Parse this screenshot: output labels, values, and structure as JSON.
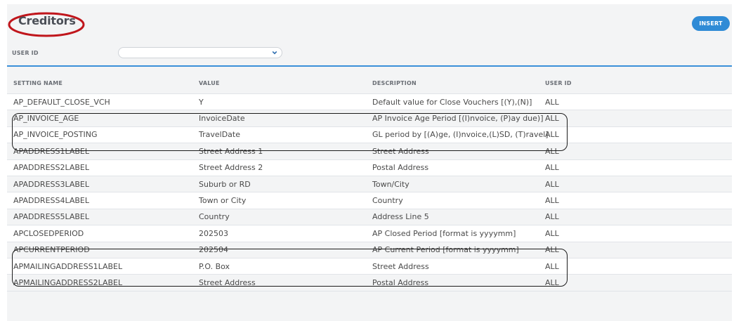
{
  "header": {
    "title": "Creditors",
    "insert_label": "INSERT"
  },
  "filter": {
    "user_id_label": "USER ID",
    "user_id_value": ""
  },
  "table": {
    "columns": [
      "SETTING NAME",
      "VALUE",
      "DESCRIPTION",
      "USER ID"
    ],
    "rows": [
      {
        "name": "AP_DEFAULT_CLOSE_VCH",
        "value": "Y",
        "description": "Default value for Close Vouchers [(Y),(N)]",
        "user": "ALL"
      },
      {
        "name": "AP_INVOICE_AGE",
        "value": "InvoiceDate",
        "description": "AP Invoice Age Period [(I)nvoice, (P)ay due)]",
        "user": "ALL"
      },
      {
        "name": "AP_INVOICE_POSTING",
        "value": "TravelDate",
        "description": "GL period by [(A)ge, (I)nvoice,(L)SD, (T)ravel]",
        "user": "ALL"
      },
      {
        "name": "APADDRESS1LABEL",
        "value": "Street Address 1",
        "description": "Street Address",
        "user": "ALL"
      },
      {
        "name": "APADDRESS2LABEL",
        "value": "Street Address 2",
        "description": "Postal Address",
        "user": "ALL"
      },
      {
        "name": "APADDRESS3LABEL",
        "value": "Suburb or RD",
        "description": "Town/City",
        "user": "ALL"
      },
      {
        "name": "APADDRESS4LABEL",
        "value": "Town or City",
        "description": "Country",
        "user": "ALL"
      },
      {
        "name": "APADDRESS5LABEL",
        "value": "Country",
        "description": "Address Line 5",
        "user": "ALL"
      },
      {
        "name": "APCLOSEDPERIOD",
        "value": "202503",
        "description": "AP Closed Period [format is yyyymm]",
        "user": "ALL"
      },
      {
        "name": "APCURRENTPERIOD",
        "value": "202504",
        "description": "AP Current Period [format is yyyymm]",
        "user": "ALL"
      },
      {
        "name": "APMAILINGADDRESS1LABEL",
        "value": "P.O. Box",
        "description": "Street Address",
        "user": "ALL"
      },
      {
        "name": "APMAILINGADDRESS2LABEL",
        "value": "Street Address",
        "description": "Postal Address",
        "user": "ALL"
      }
    ]
  },
  "colors": {
    "accent": "#2f8bd6",
    "rule": "#3a8fd9",
    "annotation_ellipse": "#c0161c",
    "annotation_box": "#1c1c1c"
  }
}
